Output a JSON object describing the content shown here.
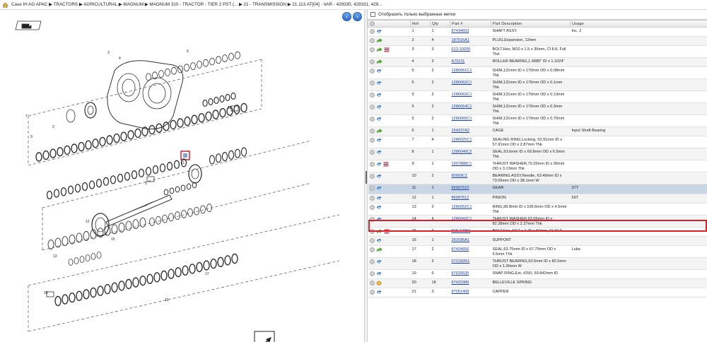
{
  "breadcrumb": [
    "Case IH AG APAC",
    "TRACTORS",
    "AGRICULTURAL",
    "MAGNUM",
    "MAGNUM 310 - TRACTOR - TIER 2 PST (...",
    "21 - TRANSMISSION",
    "21.113.AT[04] - VAR - 429330, 429331, 429..."
  ],
  "filter_label": "Отобразить только выбранные метки",
  "columns": [
    "Ref",
    "Qty",
    "Part #",
    "Part Description",
    "Usage"
  ],
  "rows": [
    {
      "ref": "1",
      "qty": "1",
      "part": "87434653",
      "desc": "SHAFT ASSY.",
      "usage": "Inc. 2"
    },
    {
      "ref": "2",
      "qty": "4",
      "part": "187516A1",
      "desc": "PLUG,Expansion, 12mm",
      "usage": ""
    },
    {
      "ref": "3",
      "qty": "3",
      "part": "613-10030",
      "desc": "BOLT,Hex, M10 x 1.5 x 30mm, Cl 8.8, Full Thd",
      "usage": ""
    },
    {
      "ref": "4",
      "qty": "2",
      "part": "A75211",
      "desc": "ROLLER BEARING,1.9685\" ID x 1.1024\"",
      "usage": ""
    },
    {
      "ref": "5",
      "qty": "2",
      "part": "1286061C1",
      "desc": "SHIM,131mm ID x 170mm OD x 0.08mm Thk",
      "usage": ""
    },
    {
      "ref": "5",
      "qty": "2",
      "part": "1286062C1",
      "desc": "SHIM,131mm ID x 170mm OD x 0.1mm Thk",
      "usage": ""
    },
    {
      "ref": "5",
      "qty": "2",
      "part": "1286063C1",
      "desc": "SHIM,131mm ID x 170mm OD x 0.13mm Thk",
      "usage": ""
    },
    {
      "ref": "5",
      "qty": "2",
      "part": "1286064C1",
      "desc": "SHIM,131mm ID x 170mm OD x 0.3mm Thk",
      "usage": ""
    },
    {
      "ref": "5",
      "qty": "2",
      "part": "1286065C1",
      "desc": "SHIM,131mm ID x 170mm OD x 0.76mm Thk",
      "usage": ""
    },
    {
      "ref": "6",
      "qty": "1",
      "part": "254337A2",
      "desc": "CAGE",
      "usage": "Input Shaft Bearing"
    },
    {
      "ref": "7",
      "qty": "4",
      "part": "1286025C1",
      "desc": "SEALING RING,Locking, 53.91mm ID x 57.91mm OD x 2.87mm Thk",
      "usage": ""
    },
    {
      "ref": "8",
      "qty": "1",
      "part": "1286040C2",
      "desc": "SEAL,63.6mm ID x 69.8mm OD x 6.5mm Thk",
      "usage": ""
    },
    {
      "ref": "9",
      "qty": "1",
      "part": "1997888C1",
      "desc": "THRUST WASHER,70.25mm ID x 95mm OD x 3.13mm Thk",
      "usage": ""
    },
    {
      "ref": "10",
      "qty": "2",
      "part": "80959C1",
      "desc": "BEARING ASSY,Needle, 63.49mm ID x 73.05mm OD x 38.1mm W",
      "usage": ""
    },
    {
      "ref": "11",
      "qty": "1",
      "part": "86987610",
      "desc": "GEAR",
      "usage": "37T"
    },
    {
      "ref": "12",
      "qty": "1",
      "part": "86987612",
      "desc": "PINION",
      "usage": "59T"
    },
    {
      "ref": "13",
      "qty": "2",
      "part": "1286052C1",
      "desc": "RING,98.8mm ID x 106.6mm OD x 4.5mm Thk",
      "usage": ""
    },
    {
      "ref": "14",
      "qty": "4",
      "part": "1286043C1",
      "desc": "THRUST WASHER,63.56mm ID x 82.38mm OD x 2.37mm Thk",
      "usage": ""
    },
    {
      "ref": "15",
      "qty": "6",
      "part": "828-12050",
      "desc": "BOLT,Hex, M12 x 1.75 x 50mm, Cl 10.9",
      "usage": ""
    },
    {
      "ref": "16",
      "qty": "1",
      "part": "281696A1",
      "desc": "SUPPORT",
      "usage": ""
    },
    {
      "ref": "17",
      "qty": "2",
      "part": "87434656",
      "desc": "SEAL,63.75mm ID x 67.75mm OD x 5.5mm Thk",
      "usage": "Lube"
    },
    {
      "ref": "18",
      "qty": "2",
      "part": "572182R1",
      "desc": "THRUST BEARING,63.5mm ID x 82.5mm OD x 1.90mm W",
      "usage": ""
    },
    {
      "ref": "19",
      "qty": "6",
      "part": "87639535",
      "desc": "SNAP RING,Ext, #250, 59.842mm ID",
      "usage": ""
    },
    {
      "ref": "20",
      "qty": "18",
      "part": "87425389",
      "desc": "BELLEVILLE SPRING",
      "usage": ""
    },
    {
      "ref": "21",
      "qty": "3",
      "part": "87051468",
      "desc": "CAPPER",
      "usage": ""
    }
  ],
  "icons": {
    "row_status": "circle-icon",
    "replace": "green-arrow-icon",
    "rotate": "blue-swirl-icon",
    "flag": "red-lines-icon",
    "box": "package-icon"
  },
  "colors": {
    "link": "#1a3fb5",
    "highlight": "#d8202a",
    "selected_row": "#c9d6e6"
  }
}
